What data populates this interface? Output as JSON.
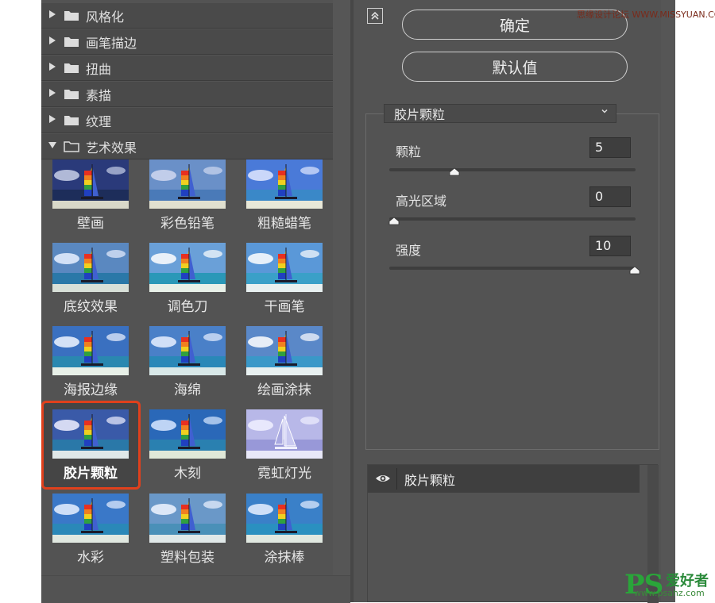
{
  "categories": [
    {
      "label": "风格化",
      "expanded": false
    },
    {
      "label": "画笔描边",
      "expanded": false
    },
    {
      "label": "扭曲",
      "expanded": false
    },
    {
      "label": "素描",
      "expanded": false
    },
    {
      "label": "纹理",
      "expanded": false
    },
    {
      "label": "艺术效果",
      "expanded": true
    }
  ],
  "filters": [
    "壁画",
    "彩色铅笔",
    "粗糙蜡笔",
    "底纹效果",
    "调色刀",
    "干画笔",
    "海报边缘",
    "海绵",
    "绘画涂抹",
    "胶片颗粒",
    "木刻",
    "霓虹灯光",
    "水彩",
    "塑料包装",
    "涂抹棒"
  ],
  "selected_filter": "胶片颗粒",
  "buttons": {
    "ok": "确定",
    "default": "默认值"
  },
  "settings": {
    "filter_name": "胶片颗粒",
    "params": [
      {
        "label": "颗粒",
        "value": "5",
        "level": 0.25
      },
      {
        "label": "高光区域",
        "value": "0",
        "level": 0.0
      },
      {
        "label": "强度",
        "value": "10",
        "level": 1.0
      }
    ]
  },
  "layers": [
    {
      "name": "胶片颗粒",
      "visible": true
    }
  ],
  "icons": {
    "collapse": "collapse-up-icon",
    "visibility": "eye-icon",
    "folder": "folder-icon"
  },
  "colors": {
    "selection_border": "#e0401c",
    "panel_bg": "#535353"
  },
  "watermark": {
    "top": "思缘设计论坛 WWW.MISSYUAN.COM",
    "ps": "PS",
    "cn": "爱好者",
    "url": "www.psahz.com"
  }
}
